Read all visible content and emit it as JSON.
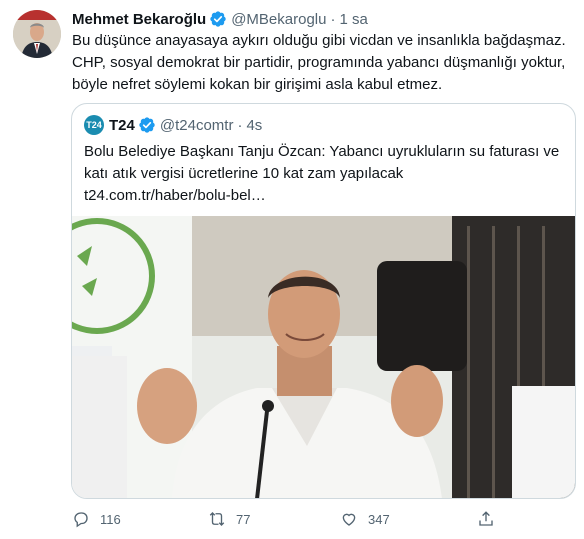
{
  "tweet": {
    "author_name": "Mehmet Bekaroğlu",
    "handle": "@MBekaroglu",
    "separator": "·",
    "time": "1 sa",
    "text_lines": [
      "Bu düşünce anayasaya aykırı olduğu gibi vicdan ve insanlıkla bağdaşmaz.",
      "CHP, sosyal demokrat bir partidir, programında yabancı düşmanlığı yoktur,",
      "böyle nefret söylemi kokan bir girişimi asla kabul etmez."
    ]
  },
  "quote": {
    "avatar_text": "T24",
    "author_name": "T24",
    "handle": "@t24comtr",
    "separator": "·",
    "time": "4s",
    "text_lines": [
      "Bolu Belediye Başkanı Tanju Özcan: Yabancı uyrukluların su faturası ve",
      "katı atık vergisi ücretlerine 10 kat zam yapılacak",
      "t24.com.tr/haber/bolu-bel…"
    ]
  },
  "actions": {
    "reply_count": "116",
    "retweet_count": "77",
    "like_count": "347"
  },
  "colors": {
    "verified": "#1d9bf0",
    "secondary_text": "#536471",
    "border": "#cfd9de"
  }
}
